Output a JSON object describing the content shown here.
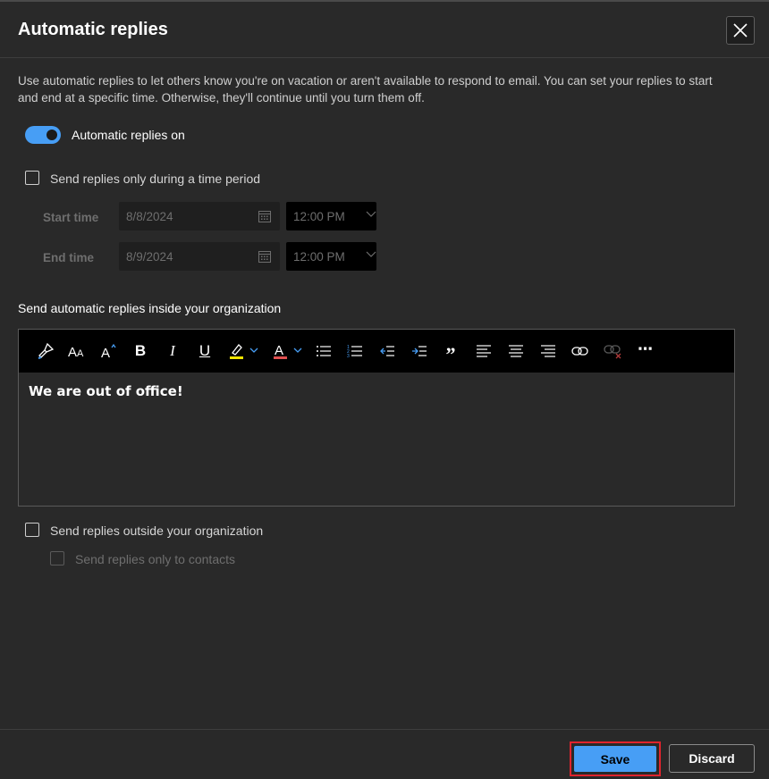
{
  "dialog": {
    "title": "Automatic replies",
    "description": "Use automatic replies to let others know you're on vacation or aren't available to respond to email. You can set your replies to start and end at a specific time. Otherwise, they'll continue until you turn them off."
  },
  "toggle": {
    "label": "Automatic replies on",
    "on": true
  },
  "time_period": {
    "checkbox_label": "Send replies only during a time period",
    "checked": false,
    "start_label": "Start time",
    "start_date": "8/8/2024",
    "start_time": "12:00 PM",
    "end_label": "End time",
    "end_date": "8/9/2024",
    "end_time": "12:00 PM"
  },
  "inside_org": {
    "section_label": "Send automatic replies inside your organization",
    "toolbar_icons": [
      "format-painter-icon",
      "font-size-icon",
      "grow-font-icon",
      "bold-icon",
      "italic-icon",
      "underline-icon",
      "highlight-icon",
      "font-color-icon",
      "bullets-icon",
      "numbering-icon",
      "decrease-indent-icon",
      "increase-indent-icon",
      "quote-icon",
      "align-left-icon",
      "align-center-icon",
      "align-right-icon",
      "insert-link-icon",
      "remove-link-icon",
      "more-options-icon"
    ],
    "message": "We are out of office!"
  },
  "outside_org": {
    "checkbox_label": "Send replies outside your organization",
    "checked": false,
    "contacts_label": "Send replies only to contacts",
    "contacts_checked": false
  },
  "footer": {
    "save_label": "Save",
    "discard_label": "Discard"
  },
  "colors": {
    "accent": "#479ef5",
    "background": "#292929",
    "highlight_border": "#e0242d"
  }
}
